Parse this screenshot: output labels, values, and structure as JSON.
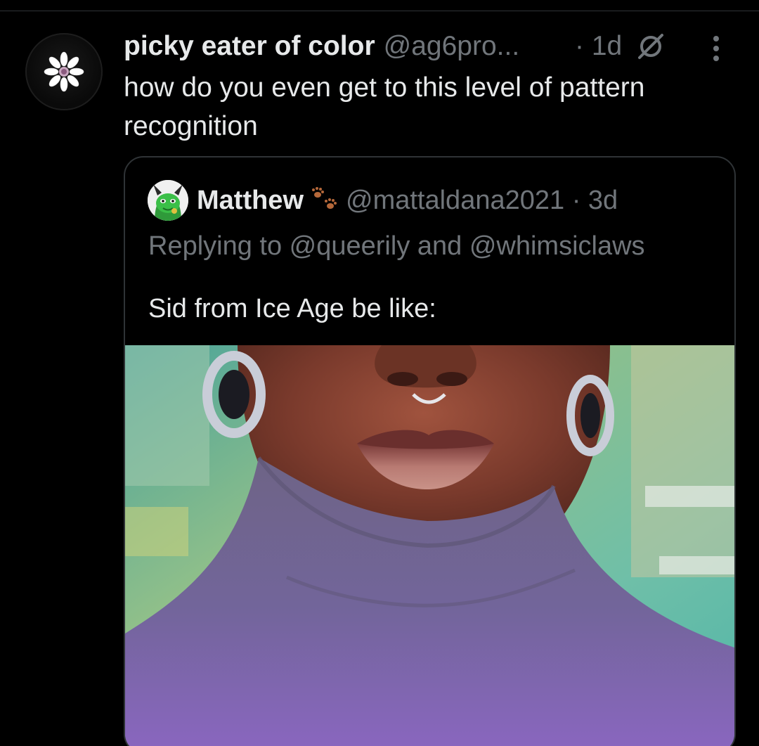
{
  "tweet": {
    "author": {
      "display_name": "picky eater of color",
      "handle": "@ag6pro...",
      "avatar_icon": "daisy-flower-icon"
    },
    "time": "· 1d",
    "text": "how do you even get to this level of pattern recognition",
    "icons": {
      "grok": "grok-icon",
      "more": "more-options-icon"
    }
  },
  "quoted_tweet": {
    "author": {
      "display_name": "Matthew",
      "badge_icon": "paw-prints-icon",
      "handle": "@mattaldana2021",
      "avatar_icon": "green-dragon-avatar"
    },
    "time": "· 3d",
    "replying_to": "Replying to @queerily and @whimsiclaws",
    "text": "Sid from Ice Age be like:",
    "media": {
      "type": "photo",
      "description_icon": "close-up-portrait-photo"
    }
  },
  "colors": {
    "background": "#000000",
    "primary_text": "#e7e9ea",
    "secondary_text": "#71767b",
    "border": "#2f3336"
  }
}
